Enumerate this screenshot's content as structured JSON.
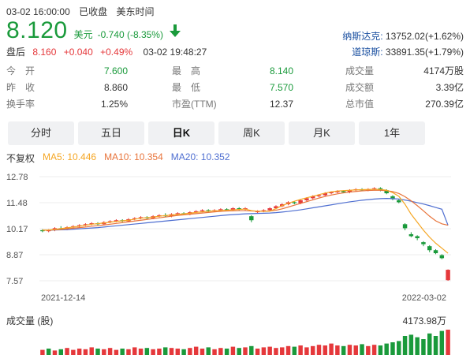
{
  "status": {
    "date_time": "03-02 16:00:00",
    "state": "已收盘",
    "tz": "美东时间"
  },
  "quote": {
    "price": "8.120",
    "currency": "美元",
    "change": "-0.740 (-8.35%)",
    "arrow": "down-arrow-icon",
    "color_down": "#1a9a3b",
    "color_up": "#e5383b"
  },
  "indices": [
    {
      "name": "纳斯达克:",
      "value": "13752.02(+1.62%)"
    },
    {
      "name": "道琼斯:",
      "value": "33891.35(+1.79%)"
    }
  ],
  "after_hours": {
    "label": "盘后",
    "price": "8.160",
    "change": "+0.040",
    "pct": "+0.49%",
    "time": "03-02 19:48:27"
  },
  "stats": [
    [
      {
        "label": "今　开",
        "value": "7.600",
        "green": true
      },
      {
        "label": "最　高",
        "value": "8.140",
        "green": true
      },
      {
        "label": "成交量",
        "value": "4174万股",
        "green": false
      }
    ],
    [
      {
        "label": "昨　收",
        "value": "8.860",
        "green": false
      },
      {
        "label": "最　低",
        "value": "7.570",
        "green": true
      },
      {
        "label": "成交额",
        "value": "3.39亿",
        "green": false
      }
    ],
    [
      {
        "label": "换手率",
        "value": "1.25%",
        "green": false
      },
      {
        "label": "市盈(TTM)",
        "value": "12.37",
        "green": false
      },
      {
        "label": "总市值",
        "value": "270.39亿",
        "green": false
      }
    ]
  ],
  "tabs": [
    "分时",
    "五日",
    "日K",
    "周K",
    "月K",
    "1年"
  ],
  "active_tab": "日K",
  "ma_legend": {
    "fq": "不复权",
    "ma5": "MA5: 10.446",
    "ma10": "MA10: 10.354",
    "ma20": "MA20: 10.352"
  },
  "chart_data": {
    "type": "candlestick",
    "y_ticks": [
      "12.78",
      "11.48",
      "10.17",
      "8.87",
      "7.57"
    ],
    "ylim": [
      7.57,
      12.78
    ],
    "x_start_label": "2021-12-14",
    "x_end_label": "2022-03-02",
    "candles": [
      [
        10.1,
        10.05,
        10.15,
        10.0
      ],
      [
        10.05,
        10.1,
        10.15,
        10.0
      ],
      [
        10.1,
        10.2,
        10.25,
        10.05
      ],
      [
        10.2,
        10.15,
        10.3,
        10.1
      ],
      [
        10.15,
        10.25,
        10.3,
        10.1
      ],
      [
        10.25,
        10.3,
        10.35,
        10.2
      ],
      [
        10.3,
        10.35,
        10.4,
        10.25
      ],
      [
        10.35,
        10.4,
        10.45,
        10.3
      ],
      [
        10.4,
        10.45,
        10.5,
        10.35
      ],
      [
        10.45,
        10.4,
        10.5,
        10.35
      ],
      [
        10.4,
        10.5,
        10.55,
        10.35
      ],
      [
        10.5,
        10.55,
        10.6,
        10.45
      ],
      [
        10.55,
        10.6,
        10.65,
        10.5
      ],
      [
        10.6,
        10.55,
        10.65,
        10.5
      ],
      [
        10.55,
        10.65,
        10.7,
        10.5
      ],
      [
        10.65,
        10.7,
        10.75,
        10.6
      ],
      [
        10.7,
        10.75,
        10.8,
        10.65
      ],
      [
        10.75,
        10.7,
        10.8,
        10.65
      ],
      [
        10.7,
        10.8,
        10.85,
        10.65
      ],
      [
        10.8,
        10.85,
        10.9,
        10.75
      ],
      [
        10.85,
        10.8,
        10.95,
        10.75
      ],
      [
        10.8,
        10.9,
        10.95,
        10.75
      ],
      [
        10.9,
        10.95,
        11.0,
        10.85
      ],
      [
        10.95,
        10.9,
        11.0,
        10.85
      ],
      [
        10.9,
        11.0,
        11.05,
        10.85
      ],
      [
        11.0,
        11.05,
        11.1,
        10.95
      ],
      [
        11.05,
        11.1,
        11.15,
        11.0
      ],
      [
        11.1,
        11.05,
        11.15,
        11.0
      ],
      [
        11.05,
        11.1,
        11.15,
        11.0
      ],
      [
        11.1,
        11.15,
        11.2,
        11.05
      ],
      [
        11.15,
        11.1,
        11.2,
        11.05
      ],
      [
        11.1,
        11.2,
        11.25,
        11.05
      ],
      [
        11.2,
        11.15,
        11.25,
        11.1
      ],
      [
        11.15,
        11.2,
        11.25,
        11.1
      ],
      [
        10.8,
        10.6,
        10.85,
        10.5
      ],
      [
        11.0,
        11.05,
        11.1,
        10.95
      ],
      [
        11.05,
        11.1,
        11.15,
        11.0
      ],
      [
        11.1,
        11.2,
        11.25,
        11.05
      ],
      [
        11.2,
        11.3,
        11.35,
        11.15
      ],
      [
        11.3,
        11.4,
        11.45,
        11.25
      ],
      [
        11.4,
        11.5,
        11.55,
        11.35
      ],
      [
        11.5,
        11.45,
        11.55,
        11.4
      ],
      [
        11.45,
        11.6,
        11.65,
        11.4
      ],
      [
        11.6,
        11.7,
        11.75,
        11.55
      ],
      [
        11.7,
        11.8,
        11.85,
        11.65
      ],
      [
        11.8,
        11.85,
        11.9,
        11.75
      ],
      [
        11.85,
        11.95,
        12.0,
        11.8
      ],
      [
        11.95,
        12.0,
        12.05,
        11.9
      ],
      [
        12.0,
        12.05,
        12.1,
        11.95
      ],
      [
        12.05,
        12.0,
        12.1,
        11.95
      ],
      [
        12.0,
        12.1,
        12.15,
        11.95
      ],
      [
        12.1,
        12.15,
        12.2,
        12.05
      ],
      [
        12.15,
        12.1,
        12.2,
        12.05
      ],
      [
        12.1,
        12.15,
        12.2,
        12.05
      ],
      [
        12.15,
        12.2,
        12.25,
        12.1
      ],
      [
        12.2,
        12.1,
        12.25,
        12.05
      ],
      [
        12.1,
        11.95,
        12.15,
        11.9
      ],
      [
        11.8,
        11.65,
        11.85,
        11.6
      ],
      [
        11.6,
        11.5,
        11.65,
        11.45
      ],
      [
        10.4,
        10.2,
        10.45,
        10.1
      ],
      [
        9.9,
        9.8,
        10.0,
        9.75
      ],
      [
        9.8,
        9.7,
        9.85,
        9.6
      ],
      [
        9.5,
        9.4,
        9.55,
        9.3
      ],
      [
        9.3,
        9.1,
        9.35,
        9.0
      ],
      [
        9.1,
        8.95,
        9.15,
        8.9
      ],
      [
        8.85,
        8.7,
        8.9,
        8.65
      ],
      [
        7.6,
        8.12,
        8.14,
        7.57
      ]
    ],
    "ma5": [
      10.1,
      10.11,
      10.14,
      10.18,
      10.22,
      10.26,
      10.3,
      10.35,
      10.4,
      10.43,
      10.46,
      10.5,
      10.54,
      10.57,
      10.6,
      10.65,
      10.7,
      10.73,
      10.76,
      10.8,
      10.83,
      10.86,
      10.89,
      10.92,
      10.95,
      10.99,
      11.02,
      11.05,
      11.07,
      11.09,
      11.1,
      11.12,
      11.14,
      11.16,
      11.08,
      11.05,
      11.04,
      11.05,
      11.18,
      11.33,
      11.45,
      11.55,
      11.64,
      11.72,
      11.8,
      11.88,
      11.96,
      12.02,
      12.06,
      12.08,
      12.1,
      12.12,
      12.13,
      12.14,
      12.15,
      12.14,
      12.1,
      11.98,
      11.8,
      11.4,
      10.9,
      10.5,
      10.1,
      9.75,
      9.45,
      9.2,
      8.95
    ],
    "ma10": [
      10.1,
      10.1,
      10.12,
      10.14,
      10.17,
      10.2,
      10.23,
      10.26,
      10.3,
      10.33,
      10.36,
      10.4,
      10.44,
      10.48,
      10.52,
      10.56,
      10.6,
      10.64,
      10.68,
      10.72,
      10.76,
      10.8,
      10.84,
      10.87,
      10.9,
      10.93,
      10.96,
      10.99,
      11.02,
      11.04,
      11.06,
      11.07,
      11.08,
      11.08,
      11.06,
      11.05,
      11.05,
      11.06,
      11.1,
      11.17,
      11.26,
      11.35,
      11.44,
      11.53,
      11.62,
      11.71,
      11.79,
      11.86,
      11.92,
      11.97,
      12.01,
      12.04,
      12.07,
      12.09,
      12.1,
      12.1,
      12.08,
      12.03,
      11.94,
      11.78,
      11.57,
      11.33,
      11.07,
      10.8,
      10.57,
      10.42,
      10.35
    ],
    "ma20": [
      10.1,
      10.1,
      10.11,
      10.12,
      10.13,
      10.15,
      10.17,
      10.19,
      10.21,
      10.23,
      10.26,
      10.29,
      10.32,
      10.35,
      10.38,
      10.41,
      10.44,
      10.47,
      10.5,
      10.53,
      10.56,
      10.59,
      10.62,
      10.65,
      10.68,
      10.71,
      10.74,
      10.77,
      10.8,
      10.83,
      10.86,
      10.88,
      10.9,
      10.92,
      10.93,
      10.94,
      10.95,
      10.96,
      10.98,
      11.01,
      11.04,
      11.08,
      11.12,
      11.17,
      11.22,
      11.27,
      11.32,
      11.37,
      11.42,
      11.47,
      11.52,
      11.56,
      11.6,
      11.63,
      11.66,
      11.68,
      11.69,
      11.68,
      11.66,
      11.61,
      11.55,
      11.48,
      11.41,
      11.33,
      11.24,
      11.15,
      10.35
    ],
    "volume_label": "成交量 (股)",
    "volume_max_label": "4173.98万",
    "volumes": [
      8,
      10,
      7,
      9,
      11,
      8,
      10,
      9,
      12,
      10,
      9,
      11,
      8,
      10,
      9,
      12,
      10,
      11,
      9,
      10,
      12,
      11,
      10,
      9,
      11,
      13,
      10,
      12,
      9,
      11,
      10,
      13,
      11,
      12,
      14,
      10,
      12,
      13,
      11,
      12,
      14,
      13,
      15,
      12,
      14,
      16,
      15,
      18,
      15,
      14,
      16,
      15,
      17,
      14,
      16,
      15,
      18,
      20,
      22,
      30,
      32,
      28,
      25,
      34,
      30,
      38,
      40
    ],
    "volume_colors_down": [
      false,
      true,
      false,
      true,
      false,
      false,
      false,
      false,
      false,
      true,
      false,
      false,
      false,
      true,
      false,
      false,
      false,
      true,
      false,
      false,
      true,
      false,
      false,
      true,
      false,
      false,
      false,
      true,
      false,
      false,
      true,
      false,
      true,
      false,
      true,
      false,
      false,
      false,
      false,
      false,
      false,
      true,
      false,
      false,
      false,
      false,
      false,
      false,
      false,
      true,
      false,
      false,
      true,
      false,
      false,
      true,
      true,
      true,
      true,
      true,
      true,
      true,
      true,
      true,
      true,
      true,
      false
    ]
  }
}
